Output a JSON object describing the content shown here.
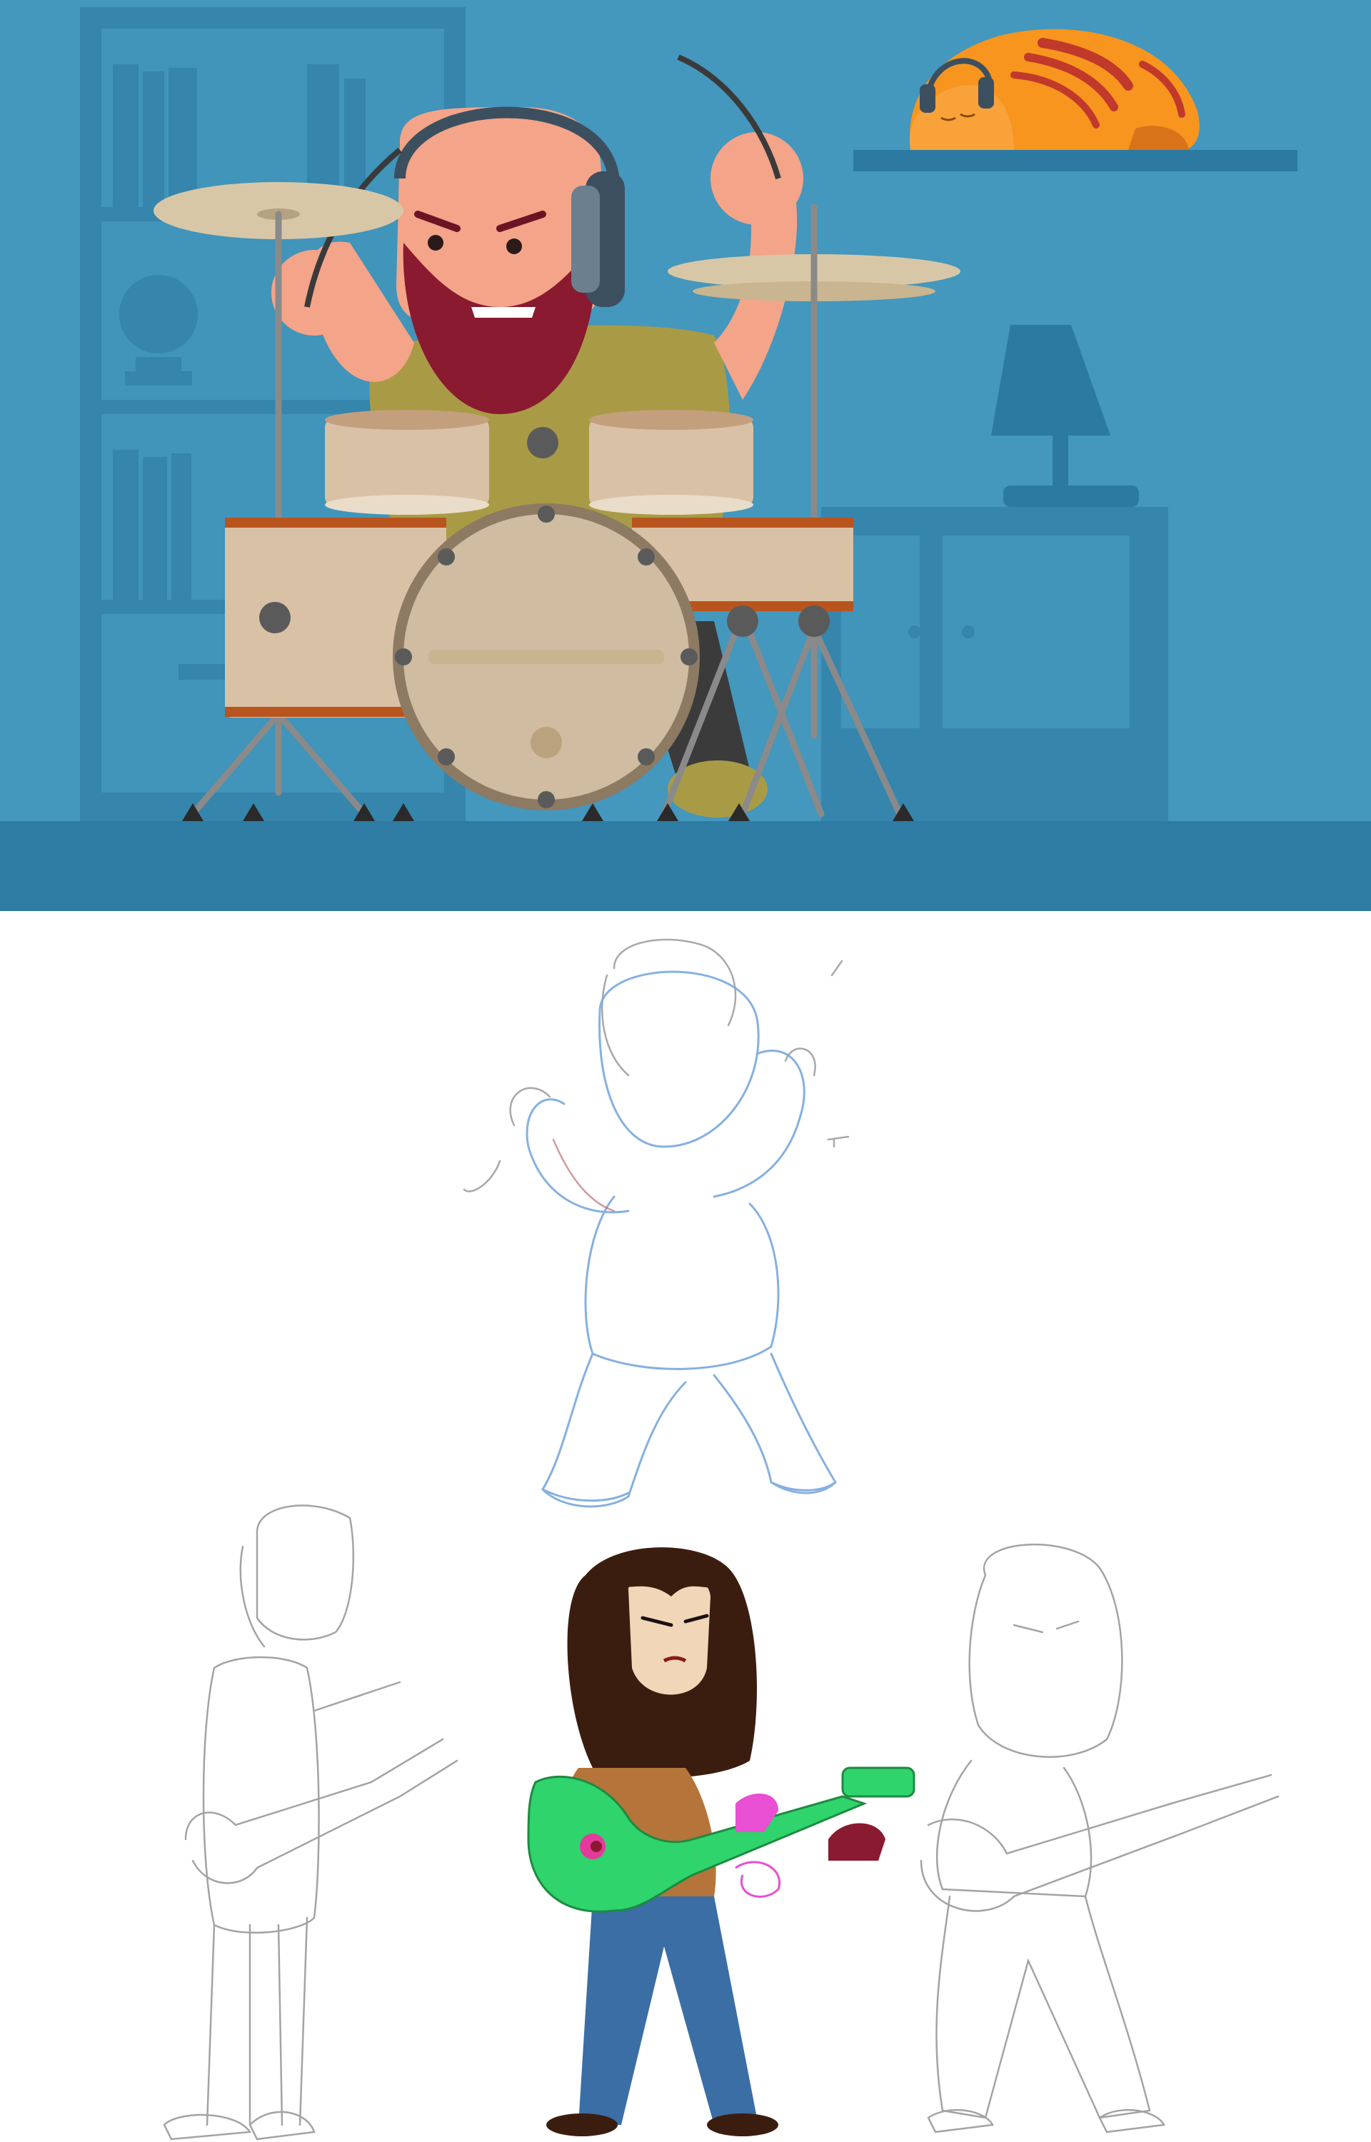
{
  "image": {
    "panels": [
      {
        "name": "drummer-illustration",
        "label": ""
      },
      {
        "name": "character-sketches",
        "label": ""
      }
    ]
  },
  "colors": {
    "wall": "#4497bd",
    "wall_shadow": "#3585ac",
    "floor": "#2e7ca3",
    "floor_front": "#3a8eb6",
    "drum_shell": "#d9c1a6",
    "drum_dark": "#c39f7d",
    "drum_rim": "#b8541e",
    "cymbal": "#d8c7a7",
    "skin": "#f4a489",
    "beard": "#8a1a30",
    "shirt": "#a99b45",
    "headphones": "#3c4f5f",
    "cat": "#f7951e",
    "cat_stripes": "#c0392b",
    "guitar": "#2fd46c",
    "guitarist_hair": "#3b1d10",
    "guitarist_jacket": "#b5743a",
    "jeans": "#3a6ea5",
    "sketch_pencil": "#9a9a9a",
    "sketch_blue": "#7aa8dd"
  },
  "icons": [
    "bald-bearded-drummer",
    "drum-kit",
    "sleeping-cat-with-headphones",
    "table-lamp",
    "bookshelf",
    "guitarist-sketch",
    "guitarist-colored",
    "drummer-rough-sketch"
  ]
}
